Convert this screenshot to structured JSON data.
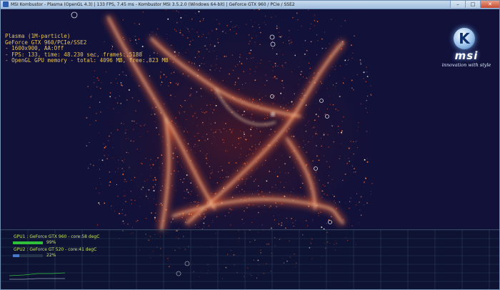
{
  "window": {
    "title": "MSI Kombustor - Plasma (OpenGL 4.3) | 133 FPS, 7.45 ms - Kombustor MSI 3.5.2.0 (Windows 64-bit) | GeForce GTX 960 / PCIe / SSE2",
    "minimize_label": "–",
    "maximize_label": "□",
    "close_label": "✕"
  },
  "hud": {
    "line1": "Plasma (1M-particle)",
    "line2": "GeForce GTX 960/PCIe/SSE2",
    "line3": "- 1600x900, AA:Off",
    "line4": "- FPS: 133, time: 48.230 sec, frames: 5188",
    "line5": "- OpenGL GPU memory - total: 4096 MB, free: 823 MB"
  },
  "logo": {
    "letter": "K",
    "brand": "msi",
    "tagline": "innovation with style"
  },
  "gpu_monitor": {
    "gpu1_label": "GPU1 : GeForce GTX 960 - core:58 degC",
    "gpu1_usage": 99,
    "gpu1_usage_text": "99%",
    "gpu1_color": "#2fbf3a",
    "gpu2_label": "GPU2 : GeForce GT 520 - core:41 degC",
    "gpu2_usage": 22,
    "gpu2_usage_text": "22%",
    "gpu2_color": "#4a78c8"
  },
  "colors": {
    "background": "#11113a",
    "hud_text": "#e8c45a",
    "plasma_core": "#fff1d8",
    "plasma_glow": "#ff7a3a",
    "plasma_dim": "#c23a1e"
  }
}
